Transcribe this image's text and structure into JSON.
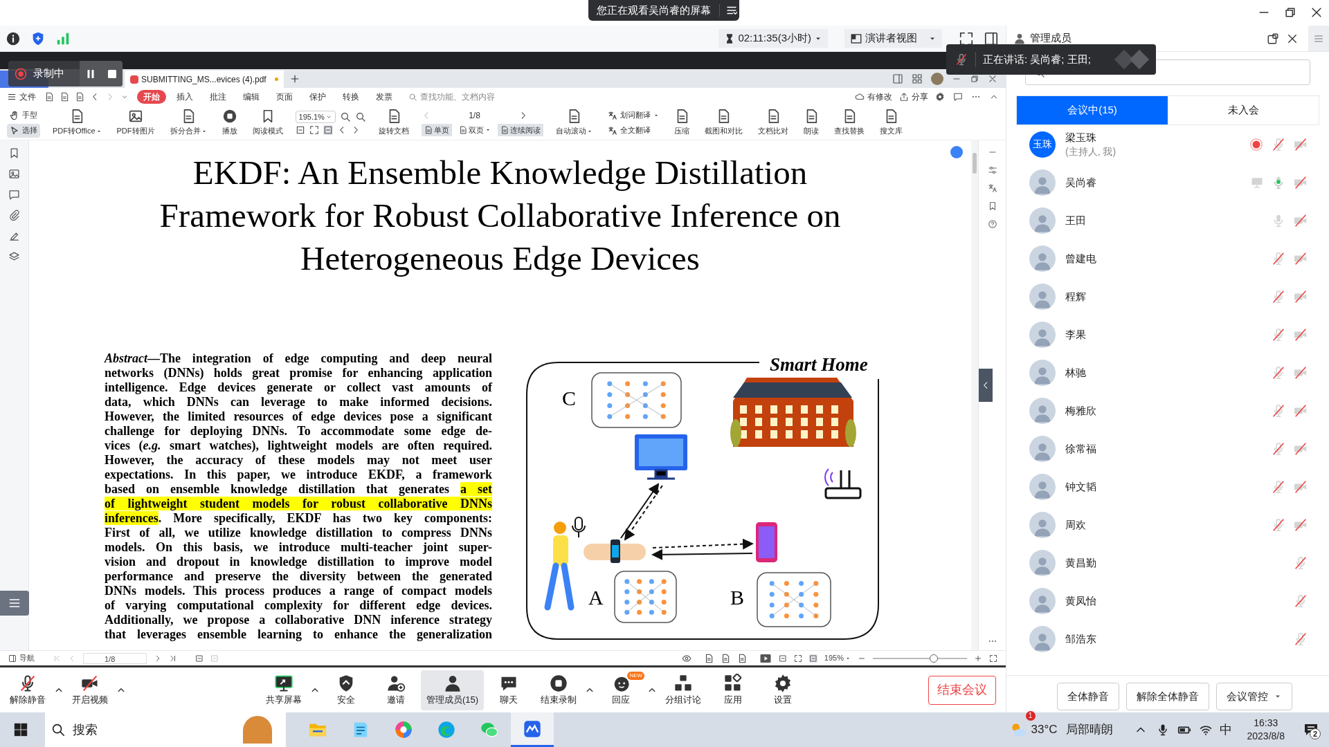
{
  "top_bar": {
    "viewing_notice": "您正在观看吴尚睿的屏幕"
  },
  "meeting_bar": {
    "timer": "02:11:35(3小时)",
    "view_mode": "演讲者视图"
  },
  "shared_screen": {
    "recording": {
      "label": "录制中"
    },
    "pdf_tabs": [
      {
        "label": "SUBMITTING_MS...evices (4).pdf",
        "modified": true
      }
    ],
    "menu": {
      "file": "文件",
      "tabs": [
        {
          "label": "开始",
          "selected": true
        },
        {
          "label": "插入",
          "selected": false
        },
        {
          "label": "批注",
          "selected": false
        },
        {
          "label": "编辑",
          "selected": false
        },
        {
          "label": "页面",
          "selected": false
        },
        {
          "label": "保护",
          "selected": false
        },
        {
          "label": "转换",
          "selected": false
        },
        {
          "label": "发票",
          "selected": false
        }
      ],
      "search_placeholder": "查找功能、文档内容",
      "actions": [
        "有修改",
        "分享"
      ]
    },
    "toolbar": [
      {
        "kind": "pair",
        "items": [
          {
            "label": "手型",
            "selected": false,
            "dropdown": false
          },
          {
            "label": "选择",
            "selected": true,
            "dropdown": false
          }
        ]
      },
      {
        "kind": "big",
        "label": "PDF转Office",
        "dropdown": true
      },
      {
        "kind": "big",
        "label": "PDF转图片",
        "dropdown": false
      },
      {
        "kind": "big",
        "label": "拆分合并",
        "dropdown": true
      },
      {
        "kind": "big",
        "label": "播放",
        "dropdown": false
      },
      {
        "kind": "big",
        "label": "阅读模式",
        "dropdown": false
      },
      {
        "kind": "zoom",
        "value": "195.1%"
      },
      {
        "kind": "big",
        "label": "旋转文档",
        "dropdown": false
      },
      {
        "kind": "pages",
        "page": "1/8",
        "items": [
          {
            "label": "单页",
            "selected": true,
            "dropdown": false
          },
          {
            "label": "双页",
            "selected": false,
            "dropdown": true
          },
          {
            "label": "连续阅读",
            "selected": true,
            "dropdown": false
          }
        ]
      },
      {
        "kind": "big",
        "label": "自动滚动",
        "dropdown": true
      },
      {
        "kind": "pair",
        "items": [
          {
            "label": "划词翻译",
            "selected": false,
            "dropdown": true
          },
          {
            "label": "全文翻译",
            "selected": false,
            "dropdown": false
          }
        ]
      },
      {
        "kind": "big",
        "label": "压缩",
        "dropdown": false
      },
      {
        "kind": "big",
        "label": "截图和对比",
        "dropdown": false
      },
      {
        "kind": "big",
        "label": "文档比对",
        "dropdown": false
      },
      {
        "kind": "big",
        "label": "朗读",
        "dropdown": false
      },
      {
        "kind": "big",
        "label": "查找替换",
        "dropdown": false
      },
      {
        "kind": "big",
        "label": "搜文库",
        "dropdown": false
      }
    ],
    "document": {
      "title_lines": [
        "EKDF: An Ensemble Knowledge Distillation",
        "Framework for Robust Collaborative Inference on",
        "Heterogeneous Edge Devices"
      ],
      "abstract_lines": [
        [
          {
            "text": "*Abstract*—The integration of edge computing and deep neural",
            "highlight": false
          }
        ],
        [
          {
            "text": "networks (DNNs) holds great promise for enhancing application",
            "highlight": false
          }
        ],
        [
          {
            "text": "intelligence. Edge devices generate or collect vast amounts of",
            "highlight": false
          }
        ],
        [
          {
            "text": "data, which DNNs can leverage to make informed decisions.",
            "highlight": false
          }
        ],
        [
          {
            "text": "However, the limited resources of edge devices pose a significant",
            "highlight": false
          }
        ],
        [
          {
            "text": "challenge for deploying DNNs. To accommodate some edge de-",
            "highlight": false
          }
        ],
        [
          {
            "text": "vices (*e.g.* smart watches), lightweight models are often required.",
            "highlight": false
          }
        ],
        [
          {
            "text": "However, the accuracy of these models may not meet user",
            "highlight": false
          }
        ],
        [
          {
            "text": "expectations. In this paper, we introduce EKDF, a framework",
            "highlight": false
          }
        ],
        [
          {
            "text": "based on ensemble knowledge distillation that generates ",
            "highlight": false
          },
          {
            "text": "a set",
            "highlight": true
          }
        ],
        [
          {
            "text": "of lightweight student models for robust collaborative DNNs",
            "highlight": true
          }
        ],
        [
          {
            "text": "inferences",
            "highlight": true
          },
          {
            "text": ". More specifically, EKDF has two key components:",
            "highlight": false
          }
        ],
        [
          {
            "text": "First of all, we utilize knowledge distillation to compress DNNs",
            "highlight": false
          }
        ],
        [
          {
            "text": "models. On this basis, we introduce multi-teacher joint super-",
            "highlight": false
          }
        ],
        [
          {
            "text": "vision and dropout in knowledge distillation to improve model",
            "highlight": false
          }
        ],
        [
          {
            "text": "performance and preserve the diversity between the generated",
            "highlight": false
          }
        ],
        [
          {
            "text": "DNNs models. This process produces a range of compact models",
            "highlight": false
          }
        ],
        [
          {
            "text": "of varying computational complexity for different edge devices.",
            "highlight": false
          }
        ],
        [
          {
            "text": "Additionally, we propose a collaborative DNN inference strategy",
            "highlight": false
          }
        ],
        [
          {
            "text": "that leverages ensemble learning to enhance the generalization",
            "highlight": false
          }
        ]
      ],
      "figure": {
        "title": "Smart Home",
        "labels": [
          "C",
          "A",
          "B"
        ]
      }
    },
    "status_bar": {
      "nav": "导航",
      "page": "1/8",
      "zoom": "195%",
      "zoom_slider": {
        "level": 0.65
      }
    }
  },
  "bottom_toolbar": {
    "items": [
      {
        "label": "解除静音",
        "menu": true,
        "selected": false
      },
      {
        "label": "开启视频",
        "menu": true,
        "selected": false
      },
      {
        "label": "共享屏幕",
        "menu": true,
        "selected": false
      },
      {
        "label": "安全",
        "menu": false,
        "selected": false
      },
      {
        "label": "邀请",
        "menu": false,
        "selected": false
      },
      {
        "label": "管理成员(15)",
        "menu": false,
        "selected": true
      },
      {
        "label": "聊天",
        "menu": false,
        "selected": false
      },
      {
        "label": "结束录制",
        "menu": true,
        "selected": false
      },
      {
        "label": "回应",
        "menu": true,
        "selected": false,
        "badge": "NEW"
      },
      {
        "label": "分组讨论",
        "menu": false,
        "selected": false
      },
      {
        "label": "应用",
        "menu": false,
        "selected": false
      },
      {
        "label": "设置",
        "menu": false,
        "selected": false
      }
    ],
    "end_button": "结束会议"
  },
  "participants_panel": {
    "title": "管理成员",
    "tabs": [
      {
        "label": "会议中(15)",
        "selected": true
      },
      {
        "label": "未入会",
        "selected": false
      }
    ],
    "participants": [
      {
        "name": "梁玉珠",
        "note": "(主持人, 我)",
        "avatar_text": "玉珠",
        "recording": true,
        "sharing": false,
        "muted": true,
        "speaking": false,
        "camera_off": true
      },
      {
        "name": "吴尚睿",
        "recording": false,
        "sharing": true,
        "muted": false,
        "speaking": true,
        "camera_off": true
      },
      {
        "name": "王田",
        "recording": false,
        "sharing": false,
        "muted": false,
        "speaking": false,
        "camera_off": true
      },
      {
        "name": "曾建电",
        "recording": false,
        "sharing": false,
        "muted": true,
        "speaking": false,
        "camera_off": true
      },
      {
        "name": "程辉",
        "recording": false,
        "sharing": false,
        "muted": true,
        "speaking": false,
        "camera_off": true
      },
      {
        "name": "李果",
        "recording": false,
        "sharing": false,
        "muted": true,
        "speaking": false,
        "camera_off": true
      },
      {
        "name": "林驰",
        "recording": false,
        "sharing": false,
        "muted": true,
        "speaking": false,
        "camera_off": true
      },
      {
        "name": "梅雅欣",
        "recording": false,
        "sharing": false,
        "muted": true,
        "speaking": false,
        "camera_off": true
      },
      {
        "name": "徐常福",
        "recording": false,
        "sharing": false,
        "muted": true,
        "speaking": false,
        "camera_off": true
      },
      {
        "name": "钟文韬",
        "recording": false,
        "sharing": false,
        "muted": true,
        "speaking": false,
        "camera_off": true
      },
      {
        "name": "周欢",
        "recording": false,
        "sharing": false,
        "muted": true,
        "speaking": false,
        "camera_off": true
      },
      {
        "name": "黄昌勤",
        "recording": false,
        "sharing": false,
        "muted": true,
        "speaking": false,
        "camera_off": false
      },
      {
        "name": "黄凤怡",
        "recording": false,
        "sharing": false,
        "muted": true,
        "speaking": false,
        "camera_off": false
      },
      {
        "name": "邹浩东",
        "recording": false,
        "sharing": false,
        "muted": true,
        "speaking": false,
        "camera_off": false
      }
    ],
    "buttons": [
      {
        "label": "全体静音",
        "dropdown": false
      },
      {
        "label": "解除全体静音",
        "dropdown": false
      },
      {
        "label": "会议管控",
        "dropdown": true
      }
    ]
  },
  "speaking_tooltip": "正在讲话: 吴尚睿; 王田;",
  "taskbar": {
    "search": "搜索",
    "apps": [
      {
        "selected": false
      },
      {
        "selected": false
      },
      {
        "selected": false
      },
      {
        "selected": false
      },
      {
        "selected": false
      },
      {
        "selected": true
      }
    ],
    "weather_badge": "1",
    "temperature": "33°C",
    "weather": "局部晴朗",
    "ime": "中",
    "time": "16:33",
    "date": "2023/8/8",
    "notifications": "2"
  }
}
